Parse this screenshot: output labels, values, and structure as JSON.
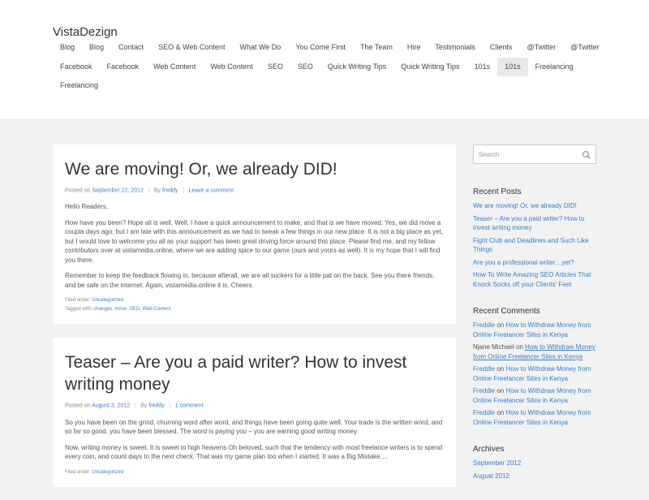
{
  "site": {
    "title": "VistaDezign"
  },
  "nav": {
    "items": [
      {
        "label": "Blog"
      },
      {
        "label": "Blog"
      },
      {
        "label": "Contact"
      },
      {
        "label": "SEO & Web Content"
      },
      {
        "label": "What We Do"
      },
      {
        "label": "You Come First"
      },
      {
        "label": "The Team"
      },
      {
        "label": "Hire"
      },
      {
        "label": "Testimonials"
      },
      {
        "label": "Clients"
      },
      {
        "label": "@Twitter"
      },
      {
        "label": "@Twitter"
      },
      {
        "label": "Facebook"
      },
      {
        "label": "Facebook"
      },
      {
        "label": "Web Content"
      },
      {
        "label": "Web Content"
      },
      {
        "label": "SEO"
      },
      {
        "label": "SEO"
      },
      {
        "label": "Quick Writing Tips"
      },
      {
        "label": "Quick Writing Tips"
      },
      {
        "label": "101s"
      },
      {
        "label": "101s",
        "active": true
      },
      {
        "label": "Freelancing"
      },
      {
        "label": "Freelancing"
      }
    ]
  },
  "posts": [
    {
      "title": "We are moving! Or, we already DID!",
      "posted_on_label": "Posted on",
      "date": "September 22, 2012",
      "by_label": "By",
      "author": "freddy",
      "comments": "Leave a comment",
      "paragraphs": [
        "Hello Readers,",
        "How have you been? Hope all is well. Well, I have a quick announcement to make, and that is we have moved. Yes, we did move a coupla days ago, but I am late with this announcement as we had to tweak a few things in our new place. It is not a big place as yet, but I would love to welcome you all as your support has been great driving force around this place. Please find me, and my fellow contributors over at vistamedia.online, where we are adding spice to our game (ours and yours as well). It is my hope that I will find you there.",
        "Remember to keep the feedback flowing in, because afterall, we are all suckers for a little pat on the back. See you there friends, and be safe on the internet. Again, vistamedia.online it is. Cheers."
      ],
      "filed_label": "Filed under:",
      "categories": [
        "Uncategorized"
      ],
      "tagged_label": "Tagged with:",
      "tags": [
        "changes",
        "move",
        "SEO",
        "Web Content"
      ]
    },
    {
      "title": "Teaser – Are you a paid writer? How to invest writing money",
      "posted_on_label": "Posted on",
      "date": "August 3, 2012",
      "by_label": "By",
      "author": "freddy",
      "comments": "1 comment",
      "paragraphs": [
        "So you have been on the grind, churning word after word, and things have been going quite well. Your trade is the written word, and so far so good, you have been blessed. The word is paying you – you are earning good writing money.",
        "Now, writing money is sweet. It is sweet to high heavens Oh beloved, such that the tendency with most freelance writers is to spend every coin, and count days to the next check. That was my game plan too when I started. It was a Big Mistake…."
      ],
      "filed_label": "Filed under:",
      "categories": [
        "Uncategorized"
      ]
    }
  ],
  "sidebar": {
    "search": {
      "placeholder": "Search"
    },
    "recent_posts": {
      "title": "Recent Posts",
      "items": [
        "We are moving! Or, we already DID!",
        "Teaser – Are you a paid writer? How to invest writing money",
        "Fight Club and Deadlines and Such Like Things",
        "Are you a professional writer…yet?",
        "How To Write Amazing SEO Articles That Knock Socks off your Clients’ Feet"
      ]
    },
    "recent_comments": {
      "title": "Recent Comments",
      "on_label": "on",
      "items": [
        {
          "author": "Freddie",
          "author_link": true,
          "post": "How to Withdraw Money from Online Freelancer Sites in Kenya"
        },
        {
          "author": "Njane Michael",
          "author_link": false,
          "post": "How to Withdraw Money from Online Freelancer Sites in Kenya",
          "underline": true
        },
        {
          "author": "Freddie",
          "author_link": true,
          "post": "How to Withdraw Money from Online Freelancer Sites in Kenya"
        },
        {
          "author": "Freddie",
          "author_link": true,
          "post": "How to Withdraw Money from Online Freelancer Sites in Kenya"
        },
        {
          "author": "Freddie",
          "author_link": true,
          "post": "How to Withdraw Money from Online Freelancer Sites in Kenya"
        }
      ]
    },
    "archives": {
      "title": "Archives",
      "items": [
        "September 2012",
        "August 2012"
      ]
    }
  },
  "colors": {
    "link": "#3a7dc9",
    "background": "#f2f2f2",
    "card": "#ffffff"
  }
}
